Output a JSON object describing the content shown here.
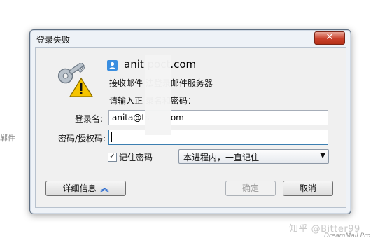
{
  "background": {
    "side_text": "郸件",
    "signature": "知乎 @Bitter99",
    "signature_sub": "DreamMail Pro"
  },
  "dialog": {
    "title": "登录失败",
    "close_symbol": "✕",
    "account": "anit        poct.com",
    "message_line1": "接收邮件        法登录邮件服务器",
    "message_line2": "请输入正        录名和密码："
  },
  "form": {
    "username_label": "登录名:",
    "username_value": "anita@ts        om",
    "password_label": "密码/授权码:",
    "password_value": "",
    "remember_label": "记住密码",
    "remember_checked": true,
    "remember_mode": "本进程内，一直记住"
  },
  "buttons": {
    "details": "详细信息",
    "ok": "确定",
    "cancel": "取消"
  },
  "colors": {
    "dialog_bg": "#eef2f7",
    "close_red": "#c9412c",
    "accent_blue": "#3a8ee0"
  }
}
